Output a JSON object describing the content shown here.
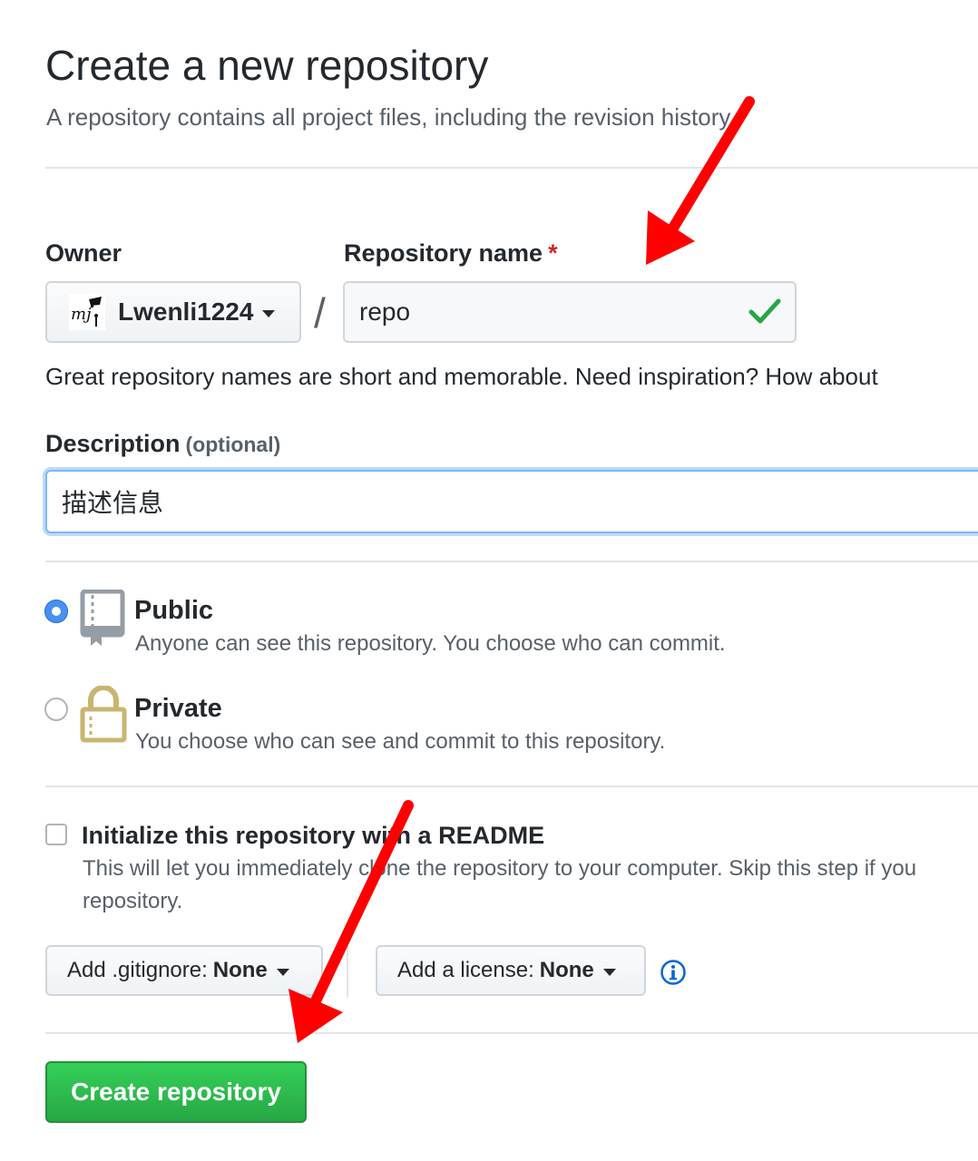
{
  "header": {
    "title": "Create a new repository",
    "subtitle": "A repository contains all project files, including the revision history."
  },
  "owner": {
    "label": "Owner",
    "value": "Lwenli1224"
  },
  "repo_name": {
    "label": "Repository name",
    "required_mark": "*",
    "value": "repo",
    "separator": "/"
  },
  "name_note": "Great repository names are short and memorable. Need inspiration? How about",
  "description": {
    "label": "Description",
    "optional": "(optional)",
    "value": "描述信息"
  },
  "visibility": {
    "public": {
      "title": "Public",
      "desc": "Anyone can see this repository. You choose who can commit.",
      "selected": true
    },
    "private": {
      "title": "Private",
      "desc": "You choose who can see and commit to this repository.",
      "selected": false
    }
  },
  "readme": {
    "title": "Initialize this repository with a README",
    "desc_line1": "This will let you immediately clone the repository to your computer. Skip this step if you",
    "desc_line2": "repository.",
    "checked": false
  },
  "gitignore": {
    "prefix": "Add .gitignore:",
    "value": "None"
  },
  "license": {
    "prefix": "Add a license:",
    "value": "None"
  },
  "submit": {
    "label": "Create repository"
  },
  "colors": {
    "accent_blue": "#4a90f2",
    "success_green": "#28a745",
    "required_red": "#cb2431",
    "annotation_arrow": "#ff0000"
  }
}
